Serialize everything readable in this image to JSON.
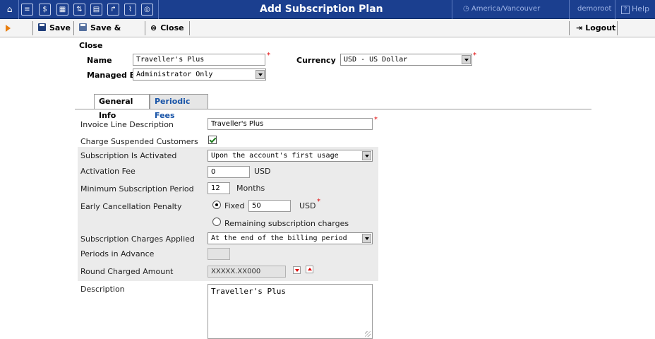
{
  "topbar": {
    "title": "Add Subscription Plan",
    "timezone": "America/Vancouver",
    "user": "demoroot",
    "help": "Help",
    "icons": [
      "home-icon",
      "list-icon",
      "dollar-icon",
      "grid-icon",
      "transfer-icon",
      "document-icon",
      "route-icon",
      "chart-icon",
      "search-icon"
    ]
  },
  "toolbar": {
    "save": "Save",
    "save_close": "Save & Close",
    "close": "Close",
    "logout": "Logout"
  },
  "header": {
    "name_label": "Name",
    "name_value": "Traveller's Plus",
    "currency_label": "Currency",
    "currency_value": "USD - US Dollar",
    "managed_label": "Managed By",
    "managed_value": "Administrator Only"
  },
  "tabs": [
    {
      "label": "General Info",
      "active": true
    },
    {
      "label": "Periodic Fees",
      "active": false
    }
  ],
  "form": {
    "invoice_label": "Invoice Line Description",
    "invoice_value": "Traveller's Plus",
    "charge_suspended_label": "Charge Suspended Customers",
    "charge_suspended_checked": true,
    "activated_label": "Subscription Is Activated",
    "activated_value": "Upon the account's first usage",
    "activation_fee_label": "Activation Fee",
    "activation_fee_value": "0",
    "activation_fee_unit": "USD",
    "min_period_label": "Minimum Subscription Period",
    "min_period_value": "12",
    "min_period_unit": "Months",
    "penalty_label": "Early Cancellation Penalty",
    "penalty_fixed_label": "Fixed",
    "penalty_fixed_value": "50",
    "penalty_unit": "USD",
    "penalty_remaining_label": "Remaining subscription charges",
    "charges_applied_label": "Subscription Charges Applied",
    "charges_applied_value": "At the end of the billing period",
    "periods_advance_label": "Periods in Advance",
    "periods_advance_value": "",
    "round_label": "Round Charged Amount",
    "round_value": "XXXXX.XX000",
    "description_label": "Description",
    "description_value": "Traveller's Plus"
  },
  "colors": {
    "topbar": "#1b3f8f",
    "tab_link": "#1a55a8",
    "required": "#e00000"
  }
}
